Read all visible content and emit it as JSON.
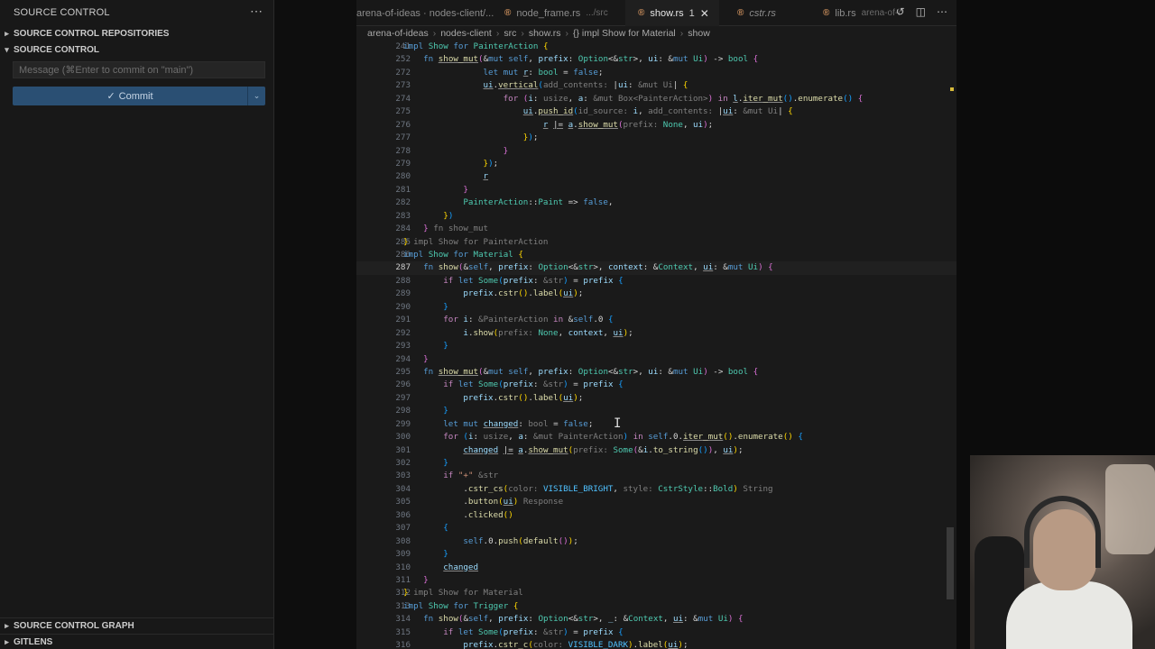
{
  "sidebar": {
    "title": "SOURCE CONTROL",
    "more_icon": "⋯",
    "sections": {
      "repositories": "SOURCE CONTROL REPOSITORIES",
      "source_control": "SOURCE CONTROL",
      "graph": "SOURCE CONTROL GRAPH",
      "gitlens": "GITLENS"
    },
    "commit_placeholder": "Message (⌘Enter to commit on \"main\")",
    "commit_label": "Commit",
    "commit_icon": "✓"
  },
  "tabs": [
    {
      "name": "arena-of-ideas · nodes-client/...",
      "detail": ""
    },
    {
      "name": "node_frame.rs",
      "detail": ".../src"
    },
    {
      "name": "show.rs",
      "detail": "1",
      "active": true
    },
    {
      "name": "cstr.rs",
      "detail": "",
      "italic": true
    },
    {
      "name": "lib.rs",
      "detail": "arena-of-i"
    }
  ],
  "tab_action_icons": [
    "history-icon",
    "split-editor-icon",
    "more-icon"
  ],
  "breadcrumb": [
    "arena-of-ideas",
    "nodes-client",
    "src",
    "show.rs",
    "{} impl Show for Material",
    "show"
  ],
  "code_lines": [
    {
      "n": "241",
      "html": "<span class=\"kb\">impl</span> <span class=\"ty\">Show</span> <span class=\"kb\">for</span> <span class=\"ty\">PainterAction</span> <span class=\"br1\">{</span>"
    },
    {
      "n": "252",
      "html": "    <span class=\"kb\">fn</span> <span class=\"fn ul\">show_mut</span><span class=\"br2\">(</span>&amp;<span class=\"kb\">mut</span> <span class=\"kb\">self</span>, <span class=\"vr\">prefix</span>: <span class=\"ty\">Option</span>&lt;&amp;<span class=\"ty\">str</span>&gt;, <span class=\"vr\">ui</span>: &amp;<span class=\"kb\">mut</span> <span class=\"ty\">Ui</span><span class=\"br2\">)</span> -&gt; <span class=\"ty\">bool</span> <span class=\"br2\">{</span>"
    },
    {
      "n": "272",
      "html": "                <span class=\"kb\">let</span> <span class=\"kb\">mut</span> <span class=\"vr ul\">r</span>: <span class=\"ty\">bool</span> = <span class=\"kb\">false</span>;"
    },
    {
      "n": "273",
      "html": "                <span class=\"vr ul\">ui</span>.<span class=\"fn ul\">vertical</span><span class=\"br3\">(</span><span class=\"hn\">add_contents:</span> |<span class=\"vr\">ui</span>: <span class=\"hn\">&amp;mut Ui</span>| <span class=\"br1\">{</span>"
    },
    {
      "n": "274",
      "html": "                    <span class=\"kw\">for</span> <span class=\"br2\">(</span><span class=\"vr\">i</span>: <span class=\"hn\">usize</span>, <span class=\"vr\">a</span>: <span class=\"hn\">&amp;mut Box&lt;PainterAction&gt;</span><span class=\"br2\">)</span> <span class=\"kw\">in</span> <span class=\"vr ul\">l</span>.<span class=\"fn ul\">iter_mut</span><span class=\"br3\">()</span>.<span class=\"fn\">enumerate</span><span class=\"br3\">()</span> <span class=\"br2\">{</span>"
    },
    {
      "n": "275",
      "html": "                        <span class=\"vr ul\">ui</span>.<span class=\"fn ul\">push_id</span><span class=\"br3\">(</span><span class=\"hn\">id_source:</span> <span class=\"vr\">i</span>, <span class=\"hn\">add_contents:</span> |<span class=\"vr ul\">ui</span>: <span class=\"hn\">&amp;mut Ui</span>| <span class=\"br1\">{</span>"
    },
    {
      "n": "276",
      "html": "                            <span class=\"vr ul\">r</span> <span class=\"ul\">|=</span> <span class=\"vr ul\">a</span>.<span class=\"fn ul\">show_mut</span><span class=\"br2\">(</span><span class=\"hn\">prefix:</span> <span class=\"ty\">None</span>, <span class=\"vr\">ui</span><span class=\"br2\">)</span>;"
    },
    {
      "n": "277",
      "html": "                        <span class=\"br1\">}</span><span class=\"br3\">)</span>;"
    },
    {
      "n": "278",
      "html": "                    <span class=\"br2\">}</span>"
    },
    {
      "n": "279",
      "html": "                <span class=\"br1\">}</span><span class=\"br3\">)</span>;"
    },
    {
      "n": "280",
      "html": "                <span class=\"vr ul\">r</span>"
    },
    {
      "n": "281",
      "html": "            <span class=\"br2\">}</span>"
    },
    {
      "n": "282",
      "html": "            <span class=\"ty\">PainterAction</span>::<span class=\"ty\">Paint</span> =&gt; <span class=\"kb\">false</span>,"
    },
    {
      "n": "283",
      "html": "        <span class=\"br1\">}</span><span class=\"br3\">)</span>"
    },
    {
      "n": "284",
      "html": "    <span class=\"br2\">}</span> <span class=\"hn\">fn show_mut</span>"
    },
    {
      "n": "285",
      "html": "<span class=\"br1\">}</span> <span class=\"hn\">impl Show for PainterAction</span>"
    },
    {
      "n": "286",
      "html": "<span class=\"kb\">impl</span> <span class=\"ty\">Show</span> <span class=\"kb\">for</span> <span class=\"ty\">Material</span> <span class=\"br1\">{</span>"
    },
    {
      "n": "287",
      "cur": true,
      "html": "    <span class=\"kb\">fn</span> <span class=\"fn\">show</span><span class=\"br2\">(</span>&amp;<span class=\"kb\">self</span>, <span class=\"vr\">prefix</span>: <span class=\"ty\">Option</span>&lt;&amp;<span class=\"ty\">str</span>&gt;, <span class=\"vr\">context</span>: &amp;<span class=\"ty\">Context</span>, <span class=\"vr ul\">ui</span>: &amp;<span class=\"kb\">mut</span> <span class=\"ty\">Ui</span><span class=\"br2\">)</span> <span class=\"br2\">{</span>"
    },
    {
      "n": "288",
      "html": "        <span class=\"kw\">if</span> <span class=\"kb\">let</span> <span class=\"ty\">Some</span><span class=\"br3\">(</span><span class=\"vr\">prefix</span>: <span class=\"hn\">&amp;str</span><span class=\"br3\">)</span> = <span class=\"vr\">prefix</span> <span class=\"br3\">{</span>"
    },
    {
      "n": "289",
      "html": "            <span class=\"vr\">prefix</span>.<span class=\"fn\">cstr</span><span class=\"br1\">()</span>.<span class=\"fn\">label</span><span class=\"br1\">(</span><span class=\"vr ul\">ui</span><span class=\"br1\">)</span>;"
    },
    {
      "n": "290",
      "html": "        <span class=\"br3\">}</span>"
    },
    {
      "n": "291",
      "html": "        <span class=\"kw\">for</span> <span class=\"vr\">i</span>: <span class=\"hn\">&amp;PainterAction</span> <span class=\"kw\">in</span> &amp;<span class=\"kb\">self</span>.0 <span class=\"br3\">{</span>"
    },
    {
      "n": "292",
      "html": "            <span class=\"vr\">i</span>.<span class=\"fn\">show</span><span class=\"br1\">(</span><span class=\"hn\">prefix:</span> <span class=\"ty\">None</span>, <span class=\"vr\">context</span>, <span class=\"vr ul\">ui</span><span class=\"br1\">)</span>;"
    },
    {
      "n": "293",
      "html": "        <span class=\"br3\">}</span>"
    },
    {
      "n": "294",
      "html": "    <span class=\"br2\">}</span>"
    },
    {
      "n": "295",
      "html": "    <span class=\"kb\">fn</span> <span class=\"fn ul\">show_mut</span><span class=\"br2\">(</span>&amp;<span class=\"kb\">mut</span> <span class=\"kb\">self</span>, <span class=\"vr\">prefix</span>: <span class=\"ty\">Option</span>&lt;&amp;<span class=\"ty\">str</span>&gt;, <span class=\"vr\">ui</span>: &amp;<span class=\"kb\">mut</span> <span class=\"ty\">Ui</span><span class=\"br2\">)</span> -&gt; <span class=\"ty\">bool</span> <span class=\"br2\">{</span>"
    },
    {
      "n": "296",
      "html": "        <span class=\"kw\">if</span> <span class=\"kb\">let</span> <span class=\"ty\">Some</span><span class=\"br3\">(</span><span class=\"vr\">prefix</span>: <span class=\"hn\">&amp;str</span><span class=\"br3\">)</span> = <span class=\"vr\">prefix</span> <span class=\"br3\">{</span>"
    },
    {
      "n": "297",
      "html": "            <span class=\"vr\">prefix</span>.<span class=\"fn\">cstr</span><span class=\"br1\">()</span>.<span class=\"fn\">label</span><span class=\"br1\">(</span><span class=\"vr ul\">ui</span><span class=\"br1\">)</span>;"
    },
    {
      "n": "298",
      "html": "        <span class=\"br3\">}</span>"
    },
    {
      "n": "299",
      "html": "        <span class=\"kb\">let</span> <span class=\"kb\">mut</span> <span class=\"vr ul\">changed</span>: <span class=\"hn\">bool</span> = <span class=\"kb\">false</span>;"
    },
    {
      "n": "300",
      "html": "        <span class=\"kw\">for</span> <span class=\"br3\">(</span><span class=\"vr\">i</span>: <span class=\"hn\">usize</span>, <span class=\"vr\">a</span>: <span class=\"hn\">&amp;mut PainterAction</span><span class=\"br3\">)</span> <span class=\"kw\">in</span> <span class=\"kb\">self</span>.0.<span class=\"fn ul\">iter_mut</span><span class=\"br1\">()</span>.<span class=\"fn\">enumerate</span><span class=\"br1\">()</span> <span class=\"br3\">{</span>"
    },
    {
      "n": "301",
      "html": "            <span class=\"vr ul\">changed</span> <span class=\"ul\">|=</span> <span class=\"vr ul\">a</span>.<span class=\"fn ul\">show_mut</span><span class=\"br1\">(</span><span class=\"hn\">prefix:</span> <span class=\"ty\">Some</span><span class=\"br2\">(</span>&amp;<span class=\"vr\">i</span>.<span class=\"fn\">to_string</span><span class=\"br3\">()</span><span class=\"br2\">)</span>, <span class=\"vr ul\">ui</span><span class=\"br1\">)</span>;"
    },
    {
      "n": "302",
      "html": "        <span class=\"br3\">}</span>"
    },
    {
      "n": "303",
      "html": "        <span class=\"kw\">if</span> <span class=\"st\">\"+\"</span> <span class=\"hn\">&amp;str</span>"
    },
    {
      "n": "304",
      "html": "            .<span class=\"fn\">cstr_cs</span><span class=\"br1\">(</span><span class=\"hn\">color:</span> <span class=\"cn\">VISIBLE_BRIGHT</span>, <span class=\"hn\">style:</span> <span class=\"ty\">CstrStyle</span>::<span class=\"ty\">Bold</span><span class=\"br1\">)</span> <span class=\"hn\">String</span>"
    },
    {
      "n": "305",
      "html": "            .<span class=\"fn\">button</span><span class=\"br1\">(</span><span class=\"vr ul\">ui</span><span class=\"br1\">)</span> <span class=\"hn\">Response</span>"
    },
    {
      "n": "306",
      "html": "            .<span class=\"fn\">clicked</span><span class=\"br1\">()</span>"
    },
    {
      "n": "307",
      "html": "        <span class=\"br3\">{</span>"
    },
    {
      "n": "308",
      "html": "            <span class=\"kb\">self</span>.0.<span class=\"fn\">push</span><span class=\"br1\">(</span><span class=\"fn\">default</span><span class=\"br2\">()</span><span class=\"br1\">)</span>;"
    },
    {
      "n": "309",
      "html": "        <span class=\"br3\">}</span>"
    },
    {
      "n": "310",
      "html": "        <span class=\"vr ul\">changed</span>"
    },
    {
      "n": "311",
      "html": "    <span class=\"br2\">}</span>"
    },
    {
      "n": "312",
      "html": "<span class=\"br1\">}</span> <span class=\"hn\">impl Show for Material</span>"
    },
    {
      "n": "313",
      "html": "<span class=\"kb\">impl</span> <span class=\"ty\">Show</span> <span class=\"kb\">for</span> <span class=\"ty\">Trigger</span> <span class=\"br1\">{</span>"
    },
    {
      "n": "314",
      "html": "    <span class=\"kb\">fn</span> <span class=\"fn\">show</span><span class=\"br2\">(</span>&amp;<span class=\"kb\">self</span>, <span class=\"vr\">prefix</span>: <span class=\"ty\">Option</span>&lt;&amp;<span class=\"ty\">str</span>&gt;, <span class=\"vr\">_</span>: &amp;<span class=\"ty\">Context</span>, <span class=\"vr ul\">ui</span>: &amp;<span class=\"kb\">mut</span> <span class=\"ty\">Ui</span><span class=\"br2\">)</span> <span class=\"br2\">{</span>"
    },
    {
      "n": "315",
      "html": "        <span class=\"kw\">if</span> <span class=\"kb\">let</span> <span class=\"ty\">Some</span><span class=\"br3\">(</span><span class=\"vr\">prefix</span>: <span class=\"hn\">&amp;str</span><span class=\"br3\">)</span> = <span class=\"vr\">prefix</span> <span class=\"br3\">{</span>"
    },
    {
      "n": "316",
      "html": "            <span class=\"vr\">prefix</span>.<span class=\"fn\">cstr_c</span><span class=\"br1\">(</span><span class=\"hn\">color:</span> <span class=\"cn\">VISIBLE_DARK</span><span class=\"br1\">)</span>.<span class=\"fn\">label</span><span class=\"br1\">(</span><span class=\"vr ul\">ui</span><span class=\"br1\">)</span>;"
    }
  ]
}
